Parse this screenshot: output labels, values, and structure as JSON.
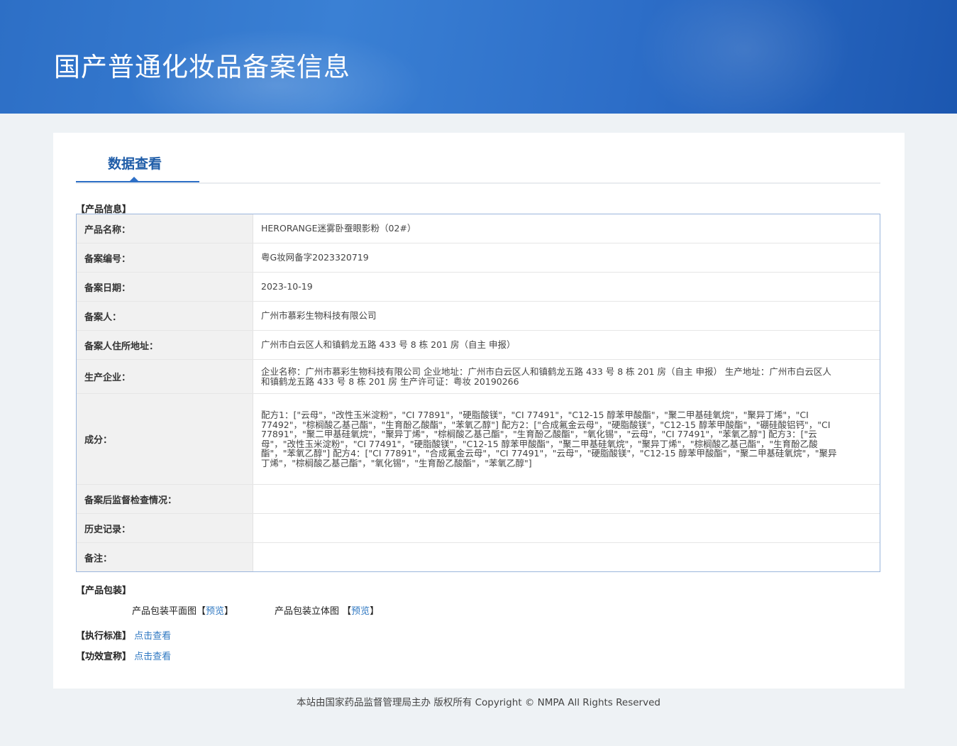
{
  "header": {
    "title": "国产普通化妆品备案信息"
  },
  "tab": {
    "label": "数据查看"
  },
  "sections": {
    "product_info": "【产品信息】",
    "packaging": "【产品包装】",
    "standard": "【执行标准】",
    "efficacy": "【功效宣称】"
  },
  "product_rows": [
    {
      "label": "产品名称：",
      "value": "HERORANGE迷雾卧蚕眼影粉（02#）"
    },
    {
      "label": "备案编号：",
      "value": "粤G妆网备字2023320719"
    },
    {
      "label": "备案日期：",
      "value": "2023-10-19"
    },
    {
      "label": "备案人：",
      "value": "广州市慕彩生物科技有限公司"
    },
    {
      "label": "备案人住所地址：",
      "value": "广州市白云区人和镇鹤龙五路 433 号 8 栋 201 房（自主 申报）"
    },
    {
      "label": "生产企业：",
      "value": "企业名称：广州市慕彩生物科技有限公司 企业地址：广州市白云区人和镇鹤龙五路 433 号 8 栋 201 房（自主 申报） 生产地址：广州市白云区人和镇鹤龙五路 433 号 8 栋 201 房 生产许可证：粤妆 20190266"
    },
    {
      "label": "成分：",
      "value": "配方1：[\"云母\"，\"改性玉米淀粉\"，\"CI 77891\"，\"硬脂酸镁\"，\"CI 77491\"，\"C12-15 醇苯甲酸酯\"，\"聚二甲基硅氧烷\"，\"聚异丁烯\"，\"CI 77492\"，\"棕榈酸乙基己酯\"，\"生育酚乙酸酯\"，\"苯氧乙醇\"] 配方2：[\"合成氟金云母\"，\"硬脂酸镁\"，\"C12-15 醇苯甲酸酯\"，\"硼硅酸铝钙\"，\"CI 77891\"，\"聚二甲基硅氧烷\"，\"聚异丁烯\"，\"棕榈酸乙基己酯\"，\"生育酚乙酸酯\"，\"氧化锡\"，\"云母\"，\"CI 77491\"，\"苯氧乙醇\"] 配方3：[\"云母\"，\"改性玉米淀粉\"，\"CI 77491\"，\"硬脂酸镁\"，\"C12-15 醇苯甲酸酯\"，\"聚二甲基硅氧烷\"，\"聚异丁烯\"，\"棕榈酸乙基己酯\"，\"生育酚乙酸酯\"，\"苯氧乙醇\"] 配方4：[\"CI 77891\"，\"合成氟金云母\"，\"CI 77491\"，\"云母\"，\"硬脂酸镁\"，\"C12-15 醇苯甲酸酯\"，\"聚二甲基硅氧烷\"，\"聚异丁烯\"，\"棕榈酸乙基己酯\"，\"氧化锡\"，\"生育酚乙酸酯\"，\"苯氧乙醇\"]"
    },
    {
      "label": "备案后监督检查情况：",
      "value": ""
    },
    {
      "label": "历史记录：",
      "value": ""
    },
    {
      "label": "备注：",
      "value": ""
    }
  ],
  "packaging": {
    "flat_label": "产品包装平面图",
    "flat_link": "预览",
    "solid_label": "产品包装立体图",
    "solid_link": "预览",
    "bracket_open": "【",
    "bracket_close": "】"
  },
  "links": {
    "view": "点击查看"
  },
  "footer": {
    "text": "本站由国家药品监督管理局主办 版权所有 Copyright © NMPA All Rights Reserved"
  }
}
